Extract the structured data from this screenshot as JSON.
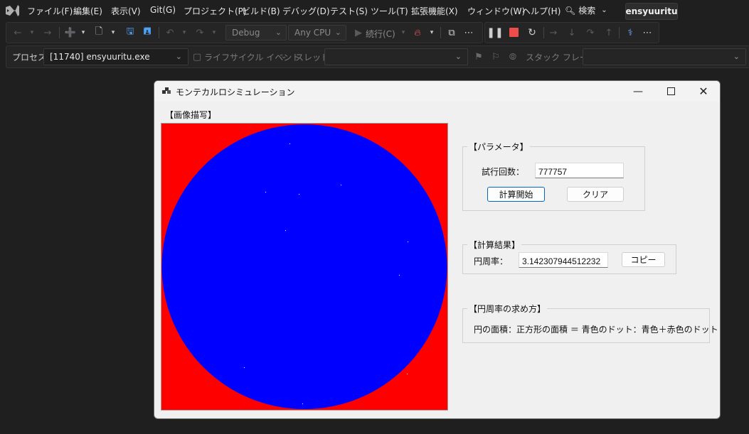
{
  "menu": {
    "items": [
      "ファイル(F)",
      "編集(E)",
      "表示(V)",
      "Git(G)",
      "プロジェクト(P)",
      "ビルド(B)",
      "デバッグ(D)",
      "テスト(S)",
      "ツール(T)",
      "拡張機能(X)",
      "ウィンドウ(W)",
      "ヘルプ(H)"
    ],
    "search_label": "検索",
    "solution_name": "ensyuuritu"
  },
  "toolbar": {
    "configuration": "Debug",
    "platform": "Any CPU",
    "continue_label": "続行(C)"
  },
  "location_bar": {
    "process_label": "プロセス:",
    "process_value": "[11740] ensyuuritu.exe",
    "lifecycle_label": "ライフサイクル イベント",
    "thread_label": "スレッド:",
    "stackframe_label": "スタック フレーム:"
  },
  "window": {
    "title": "モンテカルロシミュレーション",
    "image_section_label": "【画像描写】",
    "params": {
      "group_title": "【パラメータ】",
      "trials_label": "試行回数：",
      "trials_value": "777757",
      "start_button": "計算開始",
      "clear_button": "クリア"
    },
    "results": {
      "group_title": "【計算結果】",
      "pi_label": "円周率：",
      "pi_value": "3.142307944512232",
      "copy_button": "コピー"
    },
    "method": {
      "group_title": "【円周率の求め方】",
      "formula": "円の面積：正方形の面積 ＝ 青色のドット：青色＋赤色のドット"
    }
  },
  "colors": {
    "circle": "#0000ff",
    "square": "#ff0000",
    "stop": "#f14c4c",
    "pause": "#cfcfcf"
  }
}
